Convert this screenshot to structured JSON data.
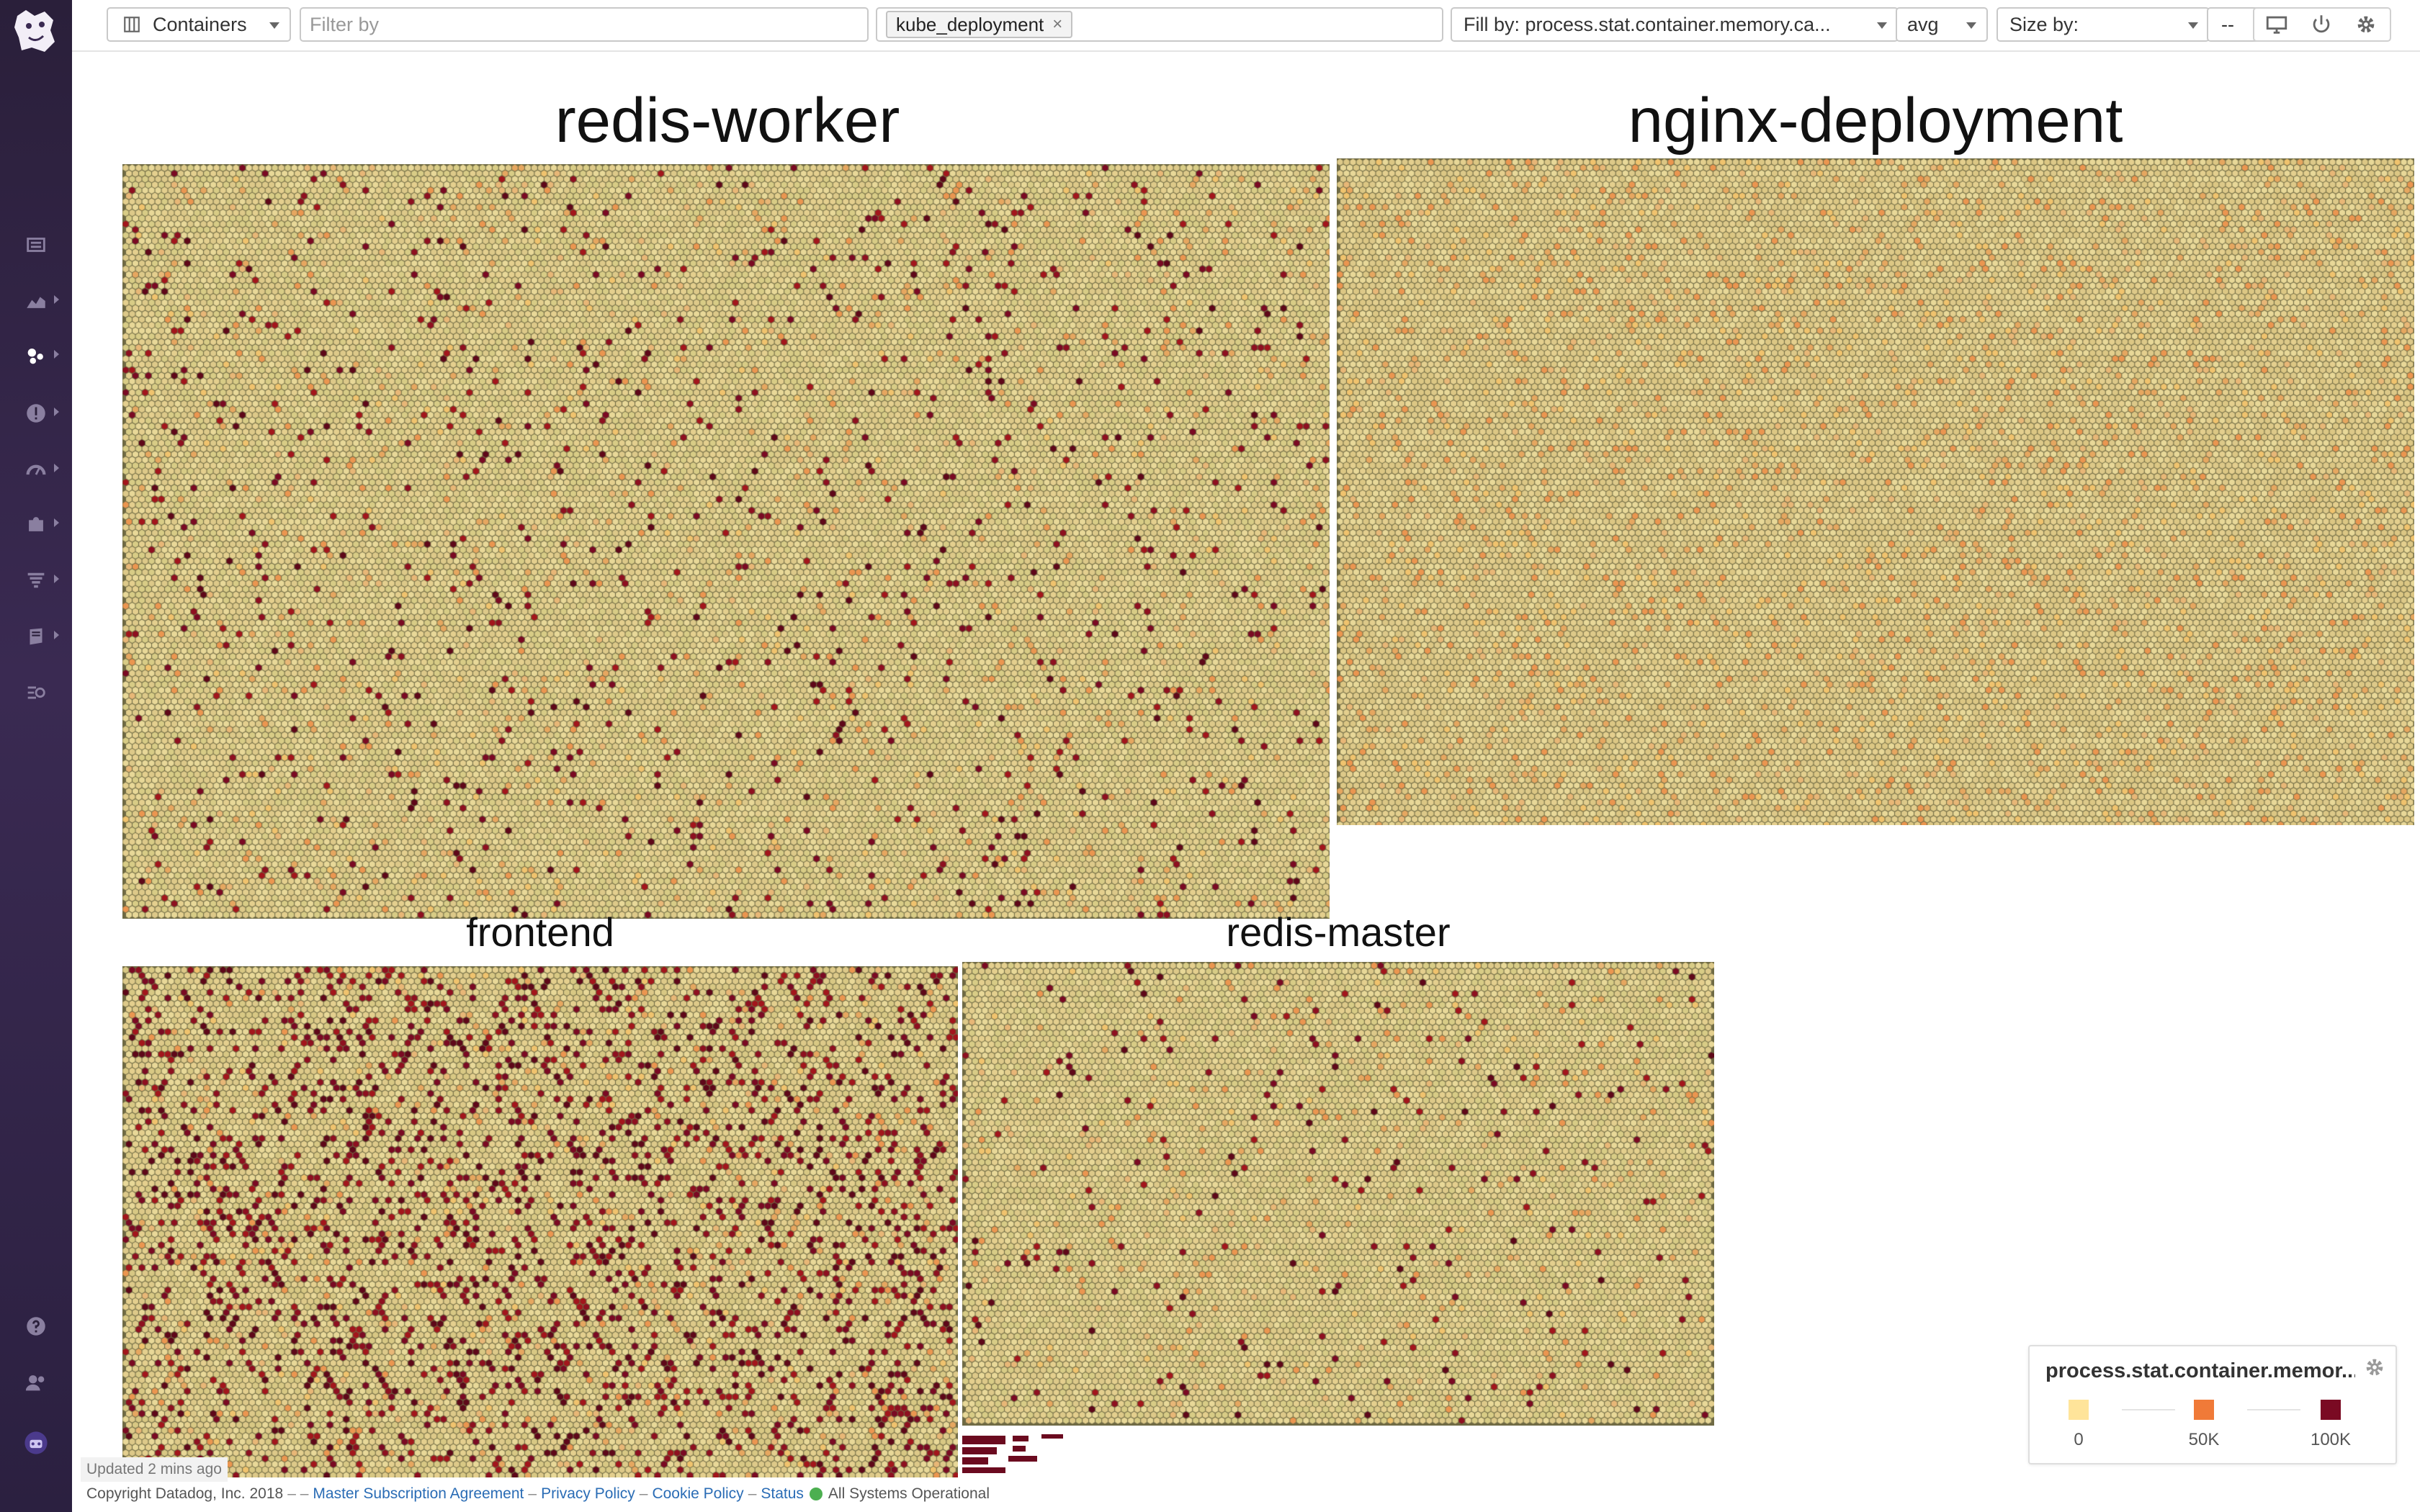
{
  "toolbar": {
    "view_selector": {
      "label": "Containers",
      "icon": "grid-icon"
    },
    "filter": {
      "placeholder": "Filter by",
      "value": ""
    },
    "group_by": {
      "tags": [
        "kube_deployment"
      ]
    },
    "fill_by": {
      "label": "Fill by: process.stat.container.memory.ca..."
    },
    "aggregation": {
      "value": "avg"
    },
    "size_by": {
      "label": "Size by:"
    },
    "size_aggregation": {
      "value": "--"
    },
    "icons": [
      "monitor-icon",
      "power-icon",
      "gear-icon"
    ]
  },
  "sidebar": {
    "logo": "datadog-logo",
    "items": [
      {
        "icon": "list-icon"
      },
      {
        "icon": "area-chart-icon"
      },
      {
        "icon": "infrastructure-icon"
      },
      {
        "icon": "alert-icon"
      },
      {
        "icon": "gauge-icon"
      },
      {
        "icon": "puzzle-icon"
      },
      {
        "icon": "logs-icon"
      },
      {
        "icon": "notebook-icon"
      },
      {
        "icon": "synthetics-icon"
      }
    ],
    "bottom_items": [
      {
        "icon": "help-icon"
      },
      {
        "icon": "team-icon"
      },
      {
        "icon": "user-avatar-icon"
      }
    ]
  },
  "map": {
    "groups": [
      {
        "name": "redis-worker",
        "seed": 11,
        "high_share": 0.035,
        "mid_share": 0.045,
        "base_color": "#d8cc86"
      },
      {
        "name": "nginx-deployment",
        "seed": 23,
        "high_share": 0.0,
        "mid_share": 0.12,
        "base_color": "#dcc784"
      },
      {
        "name": "frontend",
        "seed": 37,
        "high_share": 0.16,
        "mid_share": 0.05,
        "base_color": "#d8c884"
      },
      {
        "name": "redis-master",
        "seed": 41,
        "high_share": 0.025,
        "mid_share": 0.04,
        "base_color": "#d8cc86"
      }
    ]
  },
  "legend": {
    "title": "process.stat.container.memor...",
    "stops": [
      {
        "label": "0",
        "color": "#ffe49a"
      },
      {
        "label": "50K",
        "color": "#f07a38"
      },
      {
        "label": "100K",
        "color": "#7a0a23"
      }
    ]
  },
  "footer": {
    "updated": "Updated 2 mins ago",
    "copyright": "Copyright Datadog, Inc. 2018",
    "dashes": "– –",
    "links": [
      "Master Subscription Agreement",
      "Privacy Policy",
      "Cookie Policy",
      "Status"
    ],
    "status_text": "All Systems Operational"
  }
}
